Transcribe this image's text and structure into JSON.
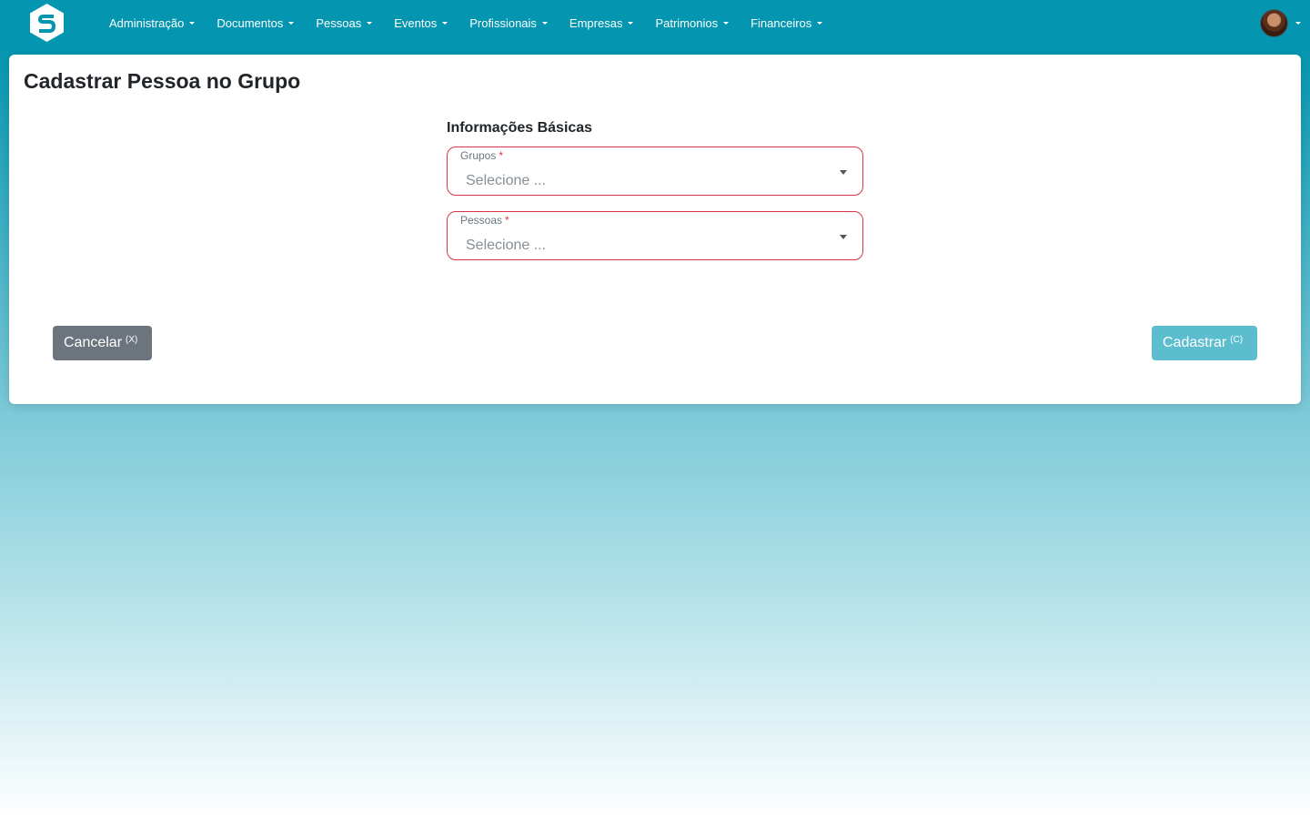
{
  "nav": {
    "logo": "S",
    "items": [
      {
        "label": "Administração"
      },
      {
        "label": "Documentos"
      },
      {
        "label": "Pessoas"
      },
      {
        "label": "Eventos"
      },
      {
        "label": "Profissionais"
      },
      {
        "label": "Empresas"
      },
      {
        "label": "Patrimonios"
      },
      {
        "label": "Financeiros"
      }
    ]
  },
  "page": {
    "title": "Cadastrar Pessoa no Grupo",
    "section_title": "Informações Básicas"
  },
  "form": {
    "grupos": {
      "label": "Grupos",
      "required_mark": "*",
      "value": "Selecione ..."
    },
    "pessoas": {
      "label": "Pessoas",
      "required_mark": "*",
      "value": "Selecione ..."
    }
  },
  "actions": {
    "cancel_label": "Cancelar",
    "cancel_shortcut": "(X)",
    "submit_label": "Cadastrar",
    "submit_shortcut": "(C)"
  },
  "colors": {
    "navbar": "#0496b1",
    "required_border": "#dc3545",
    "cancel_button": "#6c757d",
    "submit_button": "#5bbdcd"
  },
  "icons": {
    "logo": "s-logo-icon",
    "avatar": "user-avatar",
    "dropdown": "caret-down-icon"
  }
}
